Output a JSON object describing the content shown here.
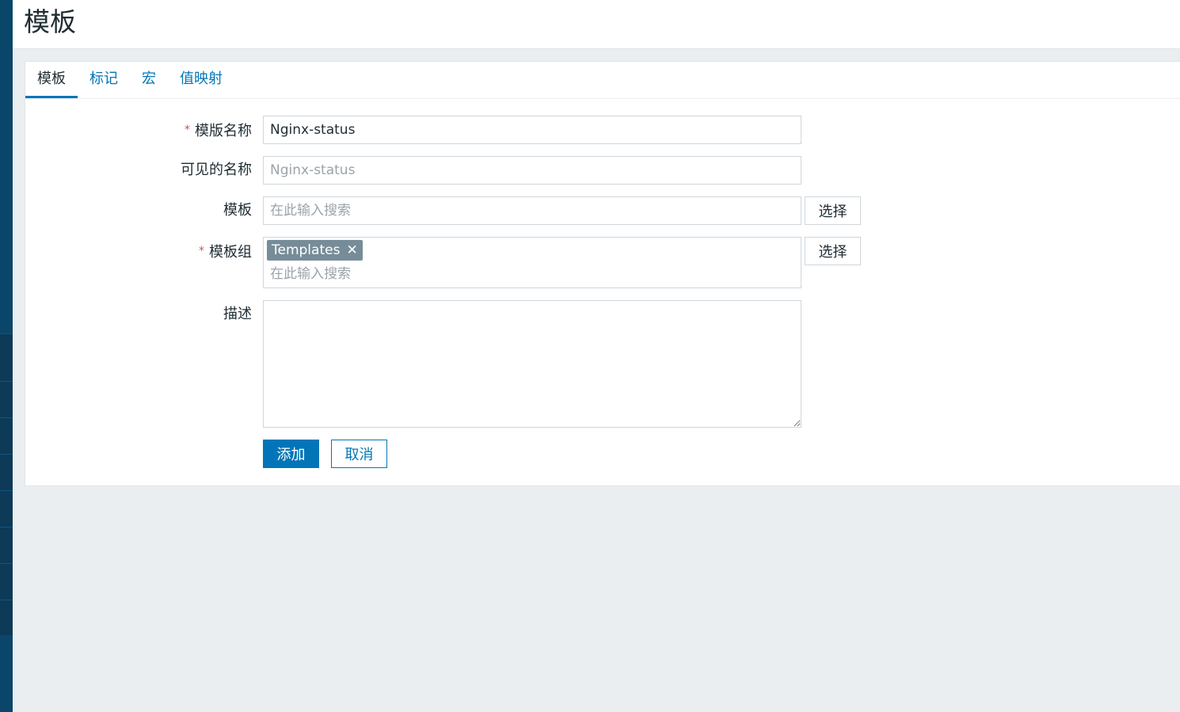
{
  "page": {
    "title": "模板"
  },
  "tabs": [
    {
      "label": "模板",
      "active": true
    },
    {
      "label": "标记",
      "active": false
    },
    {
      "label": "宏",
      "active": false
    },
    {
      "label": "值映射",
      "active": false
    }
  ],
  "form": {
    "template_name": {
      "label": "模版名称",
      "required": true,
      "value": "Nginx-status"
    },
    "visible_name": {
      "label": "可见的名称",
      "placeholder": "Nginx-status",
      "value": ""
    },
    "templates": {
      "label": "模板",
      "placeholder": "在此输入搜索",
      "select_label": "选择"
    },
    "template_groups": {
      "label": "模板组",
      "required": true,
      "selected": [
        "Templates"
      ],
      "placeholder": "在此输入搜索",
      "select_label": "选择"
    },
    "description": {
      "label": "描述",
      "value": ""
    },
    "required_marker": "*",
    "tag_remove_symbol": "✕"
  },
  "actions": {
    "add_label": "添加",
    "cancel_label": "取消"
  },
  "colors": {
    "accent": "#0275b8",
    "required": "#d64e4e",
    "tag_bg": "#768d99",
    "sidebar": "#0a466a"
  }
}
